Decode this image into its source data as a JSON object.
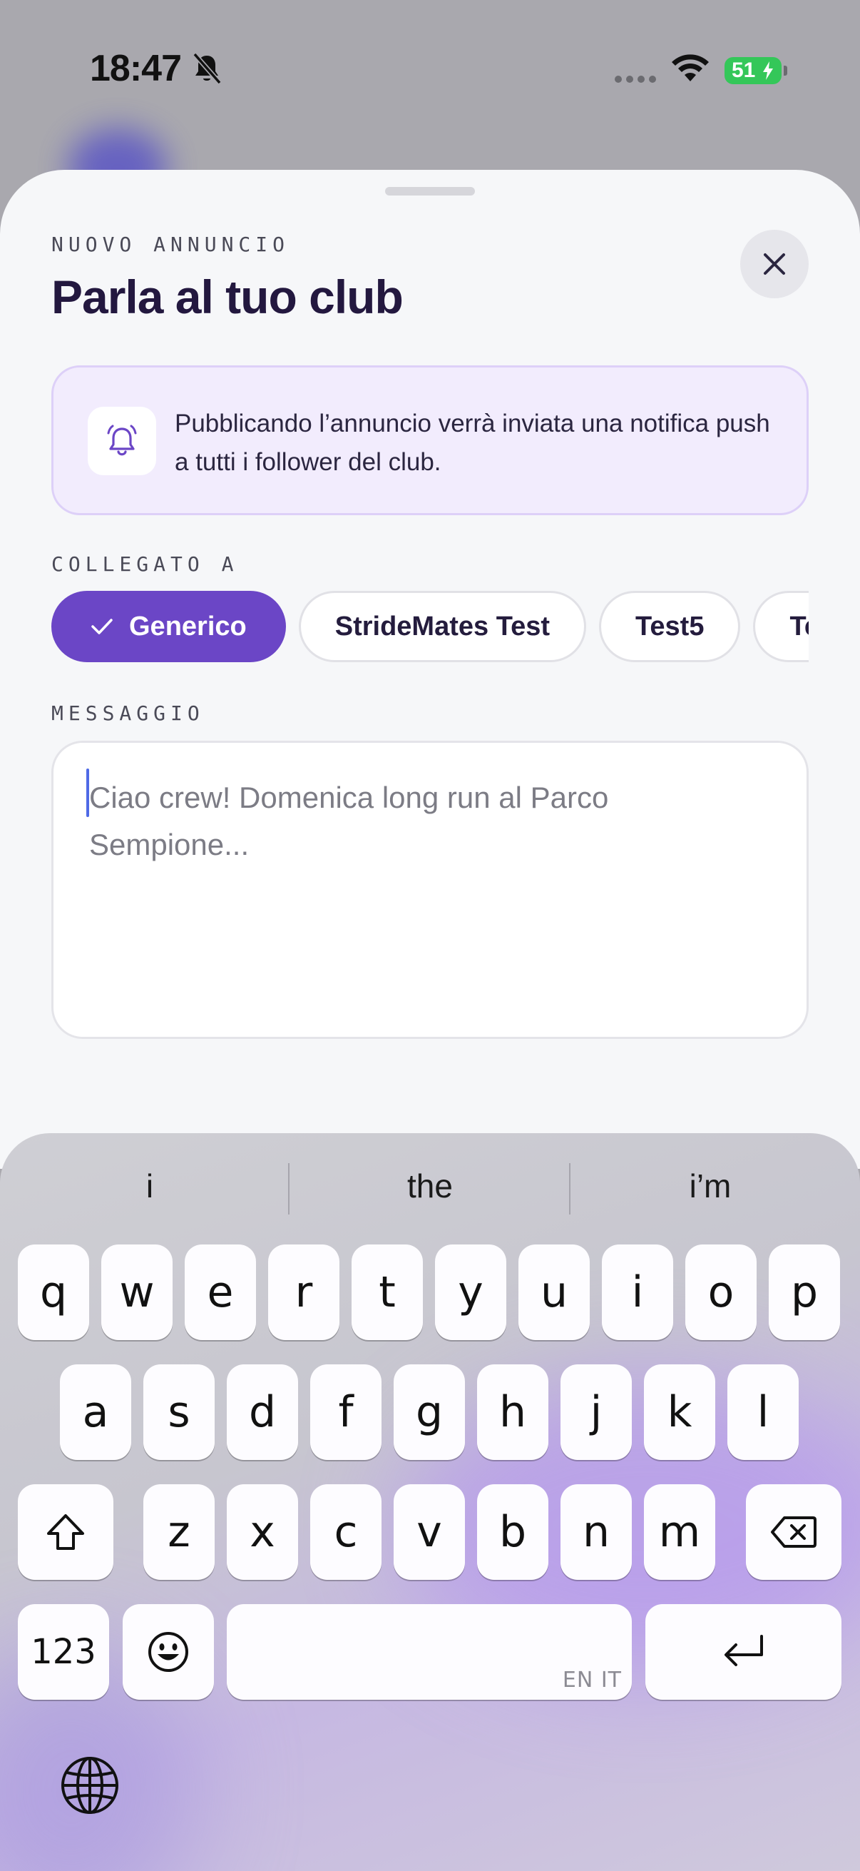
{
  "status_bar": {
    "time": "18:47",
    "battery": "51"
  },
  "sheet": {
    "eyebrow": "NUOVO ANNUNCIO",
    "title": "Parla al tuo club",
    "info_text": "Pubblicando l’annuncio verrà inviata una notifica push a tutti i follower del club.",
    "linked_label": "COLLEGATO A",
    "chips": [
      "Generico",
      "StrideMates Test",
      "Test5",
      "Te"
    ],
    "selected_chip": "Generico",
    "message_label": "MESSAGGIO",
    "message_placeholder": "Ciao crew! Domenica long run al Parco Sempione..."
  },
  "keyboard": {
    "suggestions": [
      "i",
      "the",
      "i’m"
    ],
    "row1": [
      "q",
      "w",
      "e",
      "r",
      "t",
      "y",
      "u",
      "i",
      "o",
      "p"
    ],
    "row2": [
      "a",
      "s",
      "d",
      "f",
      "g",
      "h",
      "j",
      "k",
      "l"
    ],
    "row3": [
      "z",
      "x",
      "c",
      "v",
      "b",
      "n",
      "m"
    ],
    "numbers_key": "123",
    "space_languages": "EN IT"
  },
  "icons": {
    "status": [
      "bell-off-icon",
      "wifi-icon",
      "bolt-icon"
    ],
    "sheet": [
      "close-icon",
      "bell-icon",
      "check-icon"
    ],
    "keyboard": [
      "shift-icon",
      "delete-icon",
      "emoji-icon",
      "return-icon",
      "globe-icon"
    ]
  },
  "colors": {
    "accent": "#6b46c6",
    "title": "#23183f",
    "info_bg": "#f2ecfd",
    "battery": "#34c759"
  }
}
